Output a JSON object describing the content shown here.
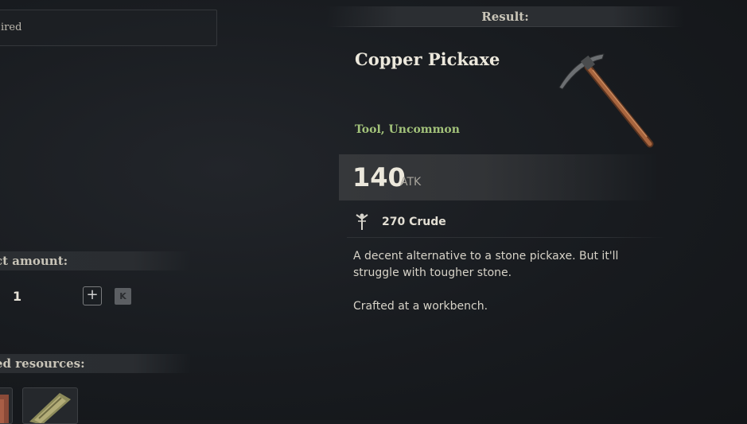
{
  "left": {
    "requirement_text": "ired",
    "amount_header": "ct amount:",
    "amount_value": "1",
    "plus_symbol": "+",
    "key_hint": "K",
    "resources_header": "ed resources:"
  },
  "result": {
    "header": "Result:",
    "item_name": "Copper Pickaxe",
    "item_category": "Tool, Uncommon",
    "atk_value": "140",
    "atk_label": "ATK",
    "material_text": "270 Crude",
    "description": "A decent alternative to a stone pickaxe. But it'll struggle with tougher stone.",
    "crafted_note": "Crafted at a workbench.",
    "item_icon": "copper-pickaxe-icon"
  },
  "colors": {
    "category_green": "#a2c27a",
    "background": "#181b1f"
  }
}
